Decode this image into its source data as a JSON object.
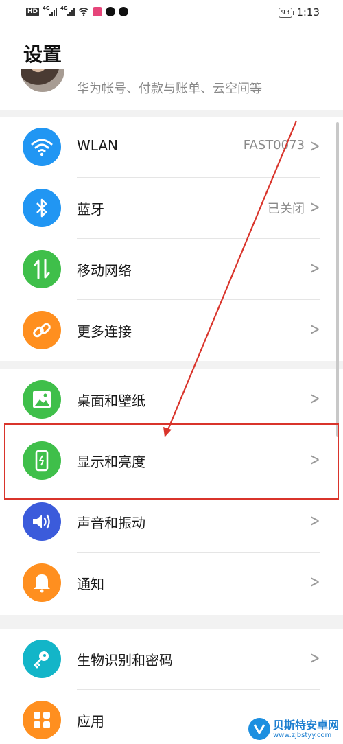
{
  "status_bar": {
    "hd": "HD",
    "signal_label": "4G",
    "battery": "93",
    "time": "1:13"
  },
  "page": {
    "title": "设置",
    "account_desc": "华为帐号、付款与账单、云空间等"
  },
  "groups": [
    {
      "items": [
        {
          "label": "WLAN",
          "value": "FAST0073",
          "icon": "wifi-icon",
          "color": "#2196f3"
        },
        {
          "label": "蓝牙",
          "value": "已关闭",
          "icon": "bluetooth-icon",
          "color": "#2196f3"
        },
        {
          "label": "移动网络",
          "value": "",
          "icon": "mobile-data-icon",
          "color": "#3fbf4a"
        },
        {
          "label": "更多连接",
          "value": "",
          "icon": "link-icon",
          "color": "#ff8f1f"
        }
      ]
    },
    {
      "items": [
        {
          "label": "桌面和壁纸",
          "value": "",
          "icon": "wallpaper-icon",
          "color": "#3fbf4a"
        },
        {
          "label": "显示和亮度",
          "value": "",
          "icon": "display-icon",
          "color": "#3fbf4a"
        },
        {
          "label": "声音和振动",
          "value": "",
          "icon": "sound-icon",
          "color": "#3b5bdb"
        },
        {
          "label": "通知",
          "value": "",
          "icon": "bell-icon",
          "color": "#ff8f1f"
        }
      ]
    },
    {
      "items": [
        {
          "label": "生物识别和密码",
          "value": "",
          "icon": "key-icon",
          "color": "#13b5c8"
        },
        {
          "label": "应用",
          "value": "",
          "icon": "apps-icon",
          "color": "#ff8f1f"
        }
      ]
    }
  ],
  "watermark": {
    "name": "贝斯特安卓网",
    "url": "www.zjbstyy.com"
  },
  "colors": {
    "highlight": "#d9342b",
    "background": "#f2f2f2"
  }
}
